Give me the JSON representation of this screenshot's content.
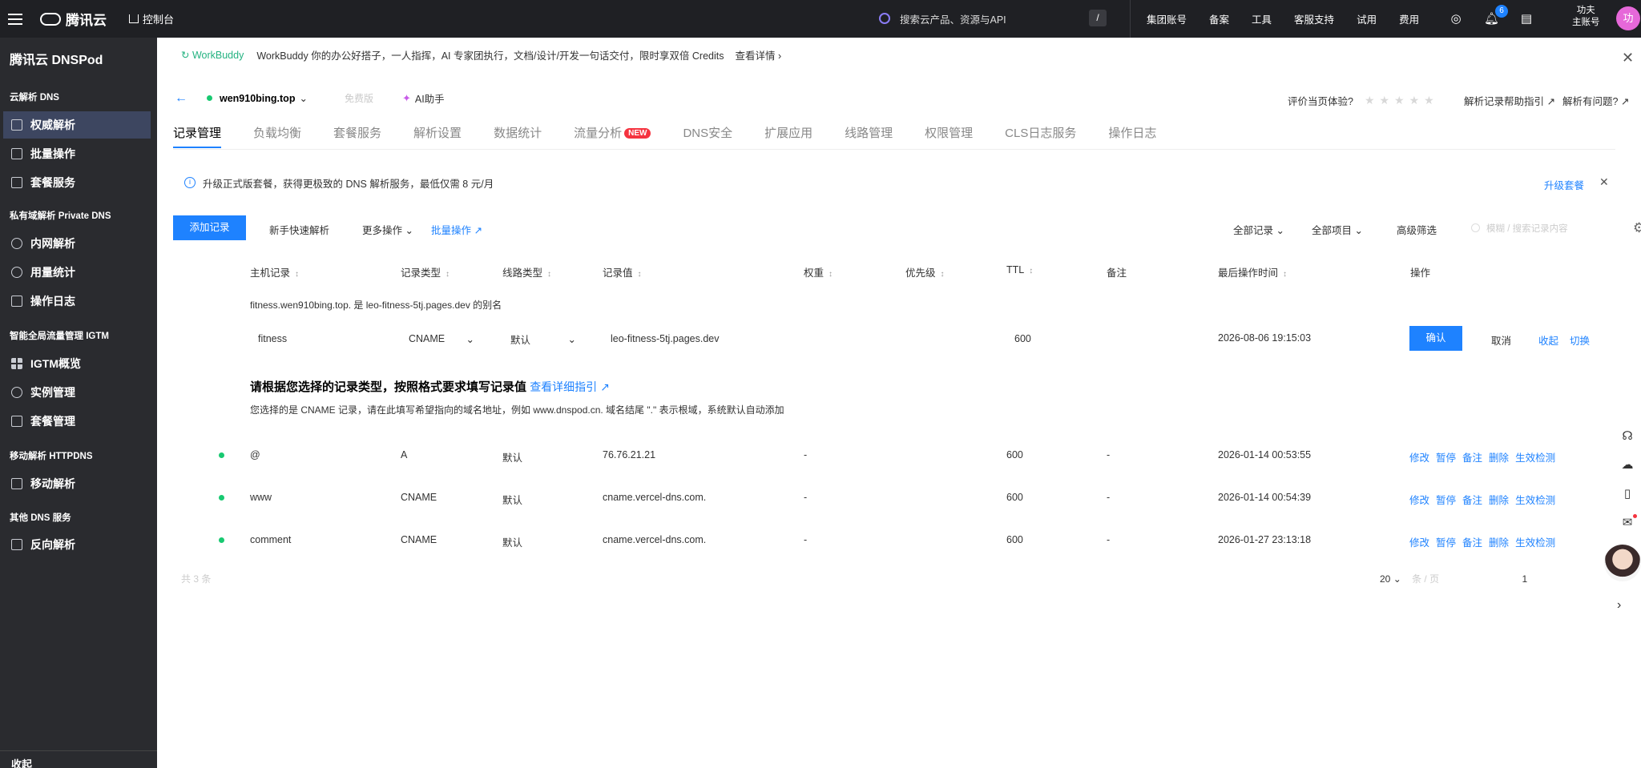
{
  "topbar": {
    "brand": "腾讯云",
    "console": "控制台",
    "search_placeholder": "搜索云产品、资源与API",
    "search_shortcut": "/",
    "nav": [
      "集团账号",
      "备案",
      "工具",
      "客服支持",
      "试用",
      "费用"
    ],
    "notification_count": "6",
    "user_name": "功夫",
    "user_role": "主账号",
    "avatar_text": "功"
  },
  "sidebar": {
    "title": "腾讯云 DNSPod",
    "groups": {
      "cloud_dns": "云解析 DNS",
      "private_dns": "私有域解析 Private DNS",
      "igtm": "智能全局流量管理 IGTM",
      "httpdns": "移动解析 HTTPDNS",
      "other": "其他 DNS 服务"
    },
    "items": {
      "auth": "权威解析",
      "batch": "批量操作",
      "package": "套餐服务",
      "intranet": "内网解析",
      "usage": "用量统计",
      "oplog": "操作日志",
      "igtm_overview": "IGTM概览",
      "instance": "实例管理",
      "pkg_mgmt": "套餐管理",
      "mobile": "移动解析",
      "reverse": "反向解析"
    },
    "bottom": "收起"
  },
  "promo": {
    "tag": "WorkBuddy",
    "text": "WorkBuddy 你的办公好搭子，一人指挥，AI 专家团执行，文档/设计/开发一句话交付，限时享双倍 Credits",
    "more": "查看详情 ›"
  },
  "domain": {
    "name": "wen910bing.top",
    "free": "免费版",
    "ai": "AI助手",
    "eval": "评价当页体验?",
    "stars": "★★★★★",
    "help1": "解析记录帮助指引 ↗",
    "help2": "解析有问题? ↗"
  },
  "tabs": [
    "记录管理",
    "负载均衡",
    "套餐服务",
    "解析设置",
    "数据统计",
    "流量分析",
    "DNS安全",
    "扩展应用",
    "线路管理",
    "权限管理",
    "CLS日志服务",
    "操作日志"
  ],
  "tab_new_badge": "NEW",
  "notice": {
    "text": "升级正式版套餐，获得更极致的 DNS 解析服务，最低仅需 8 元/月",
    "link": "升级套餐"
  },
  "toolbar": {
    "add": "添加记录",
    "quick": "新手快速解析",
    "more": "更多操作",
    "batch": "批量操作 ↗",
    "all_records": "全部记录",
    "all_projects": "全部项目",
    "advanced": "高级筛选",
    "search_placeholder": "模糊 / 搜索记录内容"
  },
  "table": {
    "headers": [
      "主机记录",
      "记录类型",
      "线路类型",
      "记录值",
      "权重",
      "优先级",
      "TTL",
      "备注",
      "最后操作时间",
      "操作"
    ],
    "alias_note": "fitness.wen910bing.top. 是 leo-fitness-5tj.pages.dev 的别名",
    "edit_row": {
      "host": "fitness",
      "type": "CNAME",
      "line": "默认",
      "value": "leo-fitness-5tj.pages.dev",
      "ttl": "600",
      "time": "2026-08-06 19:15:03",
      "confirm": "确认",
      "cancel": "取消",
      "collapse": "收起",
      "switch": "切换"
    },
    "hint_title": "请根据您选择的记录类型，按照格式要求填写记录值",
    "hint_link": "查看详细指引 ↗",
    "hint_desc": "您选择的是 CNAME 记录，请在此填写希望指向的域名地址，例如 www.dnspod.cn. 域名结尾 \".\" 表示根域，系统默认自动添加",
    "rows": [
      {
        "host": "@",
        "type": "A",
        "line": "默认",
        "value": "76.76.21.21",
        "weight": "-",
        "ttl": "600",
        "remark": "-",
        "time": "2026-01-14 00:53:55"
      },
      {
        "host": "www",
        "type": "CNAME",
        "line": "默认",
        "value": "cname.vercel-dns.com.",
        "weight": "-",
        "ttl": "600",
        "remark": "-",
        "time": "2026-01-14 00:54:39"
      },
      {
        "host": "comment",
        "type": "CNAME",
        "line": "默认",
        "value": "cname.vercel-dns.com.",
        "weight": "-",
        "ttl": "600",
        "remark": "-",
        "time": "2026-01-27 23:13:18"
      }
    ],
    "ops": [
      "修改",
      "暂停",
      "备注",
      "删除",
      "生效检测"
    ]
  },
  "pager": {
    "total": "共 3 条",
    "page_size": "20",
    "per": "条 / 页",
    "page": "1"
  }
}
